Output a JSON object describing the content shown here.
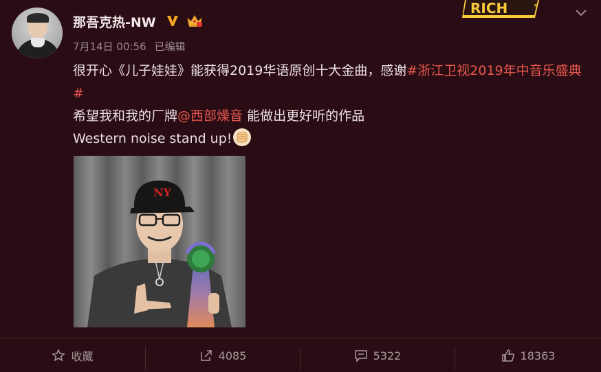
{
  "post": {
    "username": "那吾克热-NW",
    "date": "7月14日 00:56",
    "edited": "已编辑",
    "line1_prefix": "很开心《儿子娃娃》能获得2019华语原创十大金曲，感谢",
    "line1_topic": "#浙江卫视2019年中音乐盛典#",
    "line2_prefix": "希望我和我的厂牌",
    "line2_mention": "@西部燥音",
    "line2_suffix": " 能做出更好听的作品",
    "line3": "Western noise stand up!",
    "badges": {
      "verified": "v-verified-icon",
      "member": "crown-icon"
    }
  },
  "decorations": {
    "rich_card_text": "RICH"
  },
  "actions": {
    "favorite_label": "收藏",
    "repost_count": "4085",
    "comment_count": "5322",
    "like_count": "18363"
  },
  "colors": {
    "background": "#2a0d14",
    "link": "#e8584f",
    "text": "#ece0e3",
    "muted": "#a8999c"
  }
}
